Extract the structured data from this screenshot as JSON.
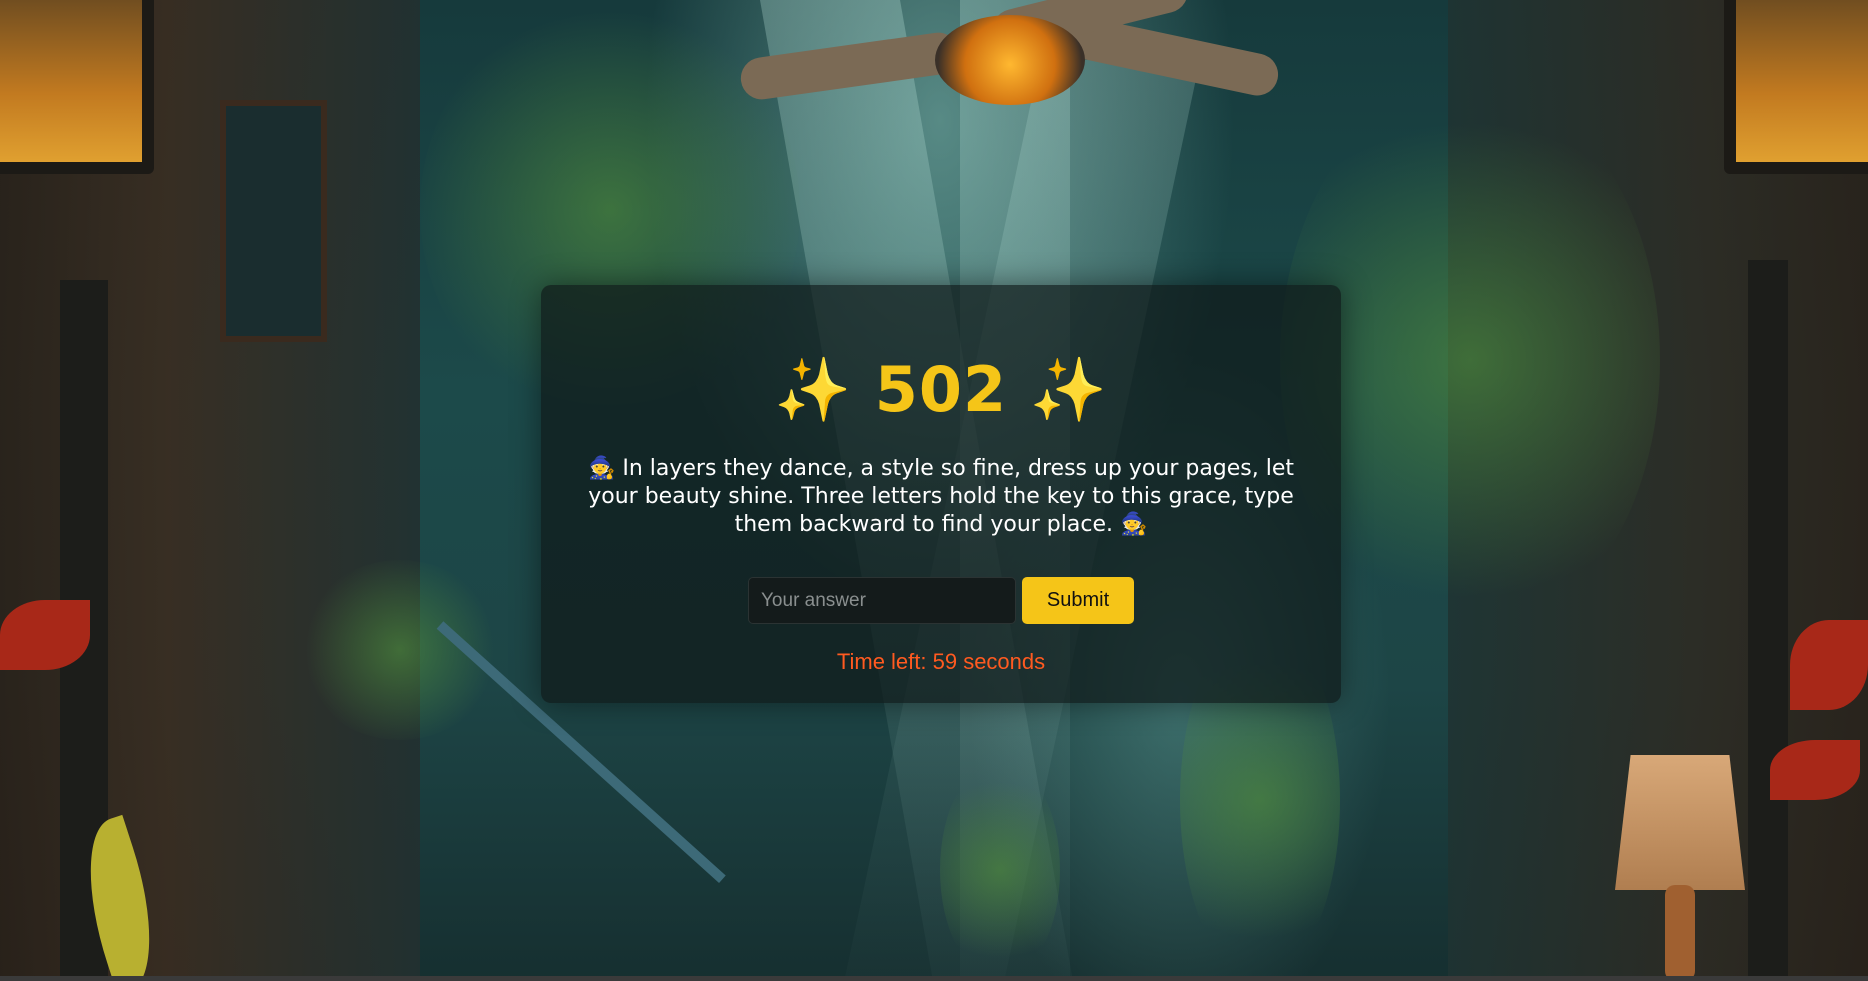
{
  "card": {
    "title": "✨ 502 ✨",
    "riddle": "🧙 In layers they dance, a style so fine, dress up your pages, let your beauty shine. Three letters hold the key to this grace, type them backward to find your place. 🧙",
    "answer_placeholder": "Your answer",
    "answer_value": "",
    "submit_label": "Submit",
    "timer_text": "Time left: 59 seconds"
  },
  "colors": {
    "accent": "#f5c518",
    "timer": "#ff5a20",
    "card_background": "rgba(15,25,25,0.72)"
  }
}
